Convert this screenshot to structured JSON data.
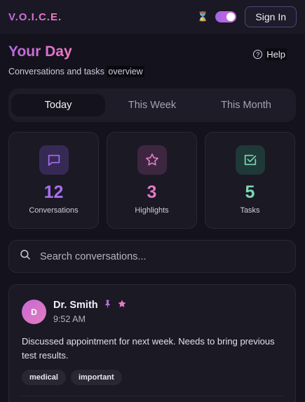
{
  "brand": "V.O.I.C.E.",
  "header": {
    "theme_icon": "hourglass-icon",
    "toggle_state": "on",
    "signin_label": "Sign In"
  },
  "page": {
    "title": "Your Day",
    "subtitle_start": "Conversations and tasks",
    "subtitle_highlight": "overview",
    "help_label": "Help"
  },
  "tabs": [
    {
      "label": "Today",
      "active": true
    },
    {
      "label": "This Week",
      "active": false
    },
    {
      "label": "This Month",
      "active": false
    }
  ],
  "stats": [
    {
      "value": "12",
      "label": "Conversations",
      "icon": "chat-bubble-icon",
      "color": "#a86ef0"
    },
    {
      "value": "3",
      "label": "Highlights",
      "icon": "star-icon",
      "color": "#e17bc6"
    },
    {
      "value": "5",
      "label": "Tasks",
      "icon": "checkbox-icon",
      "color": "#7ed7b5"
    }
  ],
  "search": {
    "placeholder": "Search conversations..."
  },
  "conversation": {
    "avatar_initial": "D",
    "name": "Dr. Smith",
    "time": "9:52 AM",
    "body": "Discussed appointment for next week. Needs to bring previous test results.",
    "tags": [
      "medical",
      "important"
    ],
    "pinned": true,
    "starred": true
  }
}
